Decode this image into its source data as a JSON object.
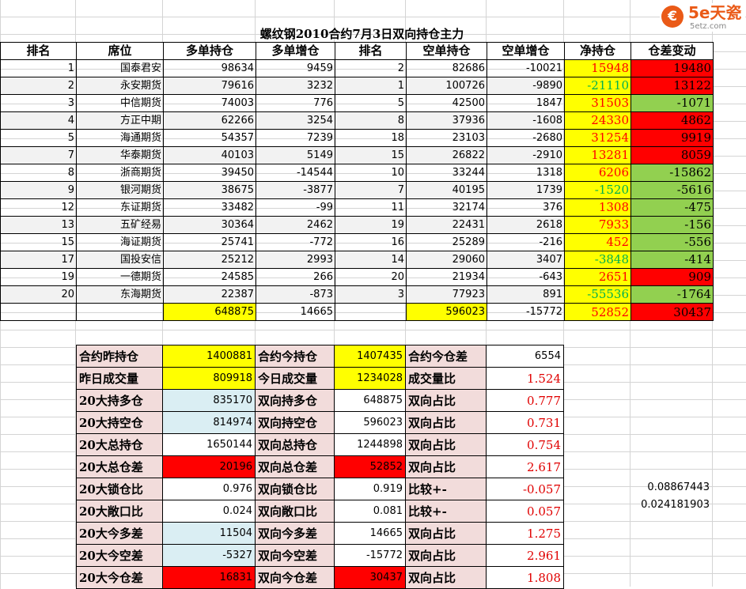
{
  "logo": {
    "icon_text": "€",
    "name": "5e天瓷",
    "url": "5etz.com"
  },
  "title": "螺纹钢2010合约7月3日双向持仓主力",
  "colors": {
    "yellow": "#ffff00",
    "red": "#ff0000",
    "green": "#92d050",
    "light_blue": "#daeef3",
    "pink": "#f2dcdb",
    "net_red_text": "#ff0000",
    "net_green_text": "#00b050"
  },
  "headers": [
    "排名",
    "席位",
    "多单持仓",
    "多单增仓",
    "排名",
    "空单持仓",
    "空单增仓",
    "净持仓",
    "仓差变动"
  ],
  "rows": [
    {
      "rank": "1",
      "broker": "国泰君安",
      "long": "98634",
      "long_chg": "9459",
      "rank2": "2",
      "short": "82686",
      "short_chg": "-10021",
      "net": "15948",
      "diff": "19480"
    },
    {
      "rank": "2",
      "broker": "永安期货",
      "long": "79616",
      "long_chg": "3232",
      "rank2": "1",
      "short": "100726",
      "short_chg": "-9890",
      "net": "-21110",
      "diff": "13122"
    },
    {
      "rank": "3",
      "broker": "中信期货",
      "long": "74003",
      "long_chg": "776",
      "rank2": "5",
      "short": "42500",
      "short_chg": "1847",
      "net": "31503",
      "diff": "-1071"
    },
    {
      "rank": "4",
      "broker": "方正中期",
      "long": "62266",
      "long_chg": "3254",
      "rank2": "8",
      "short": "37936",
      "short_chg": "-1608",
      "net": "24330",
      "diff": "4862"
    },
    {
      "rank": "5",
      "broker": "海通期货",
      "long": "54357",
      "long_chg": "7239",
      "rank2": "18",
      "short": "23103",
      "short_chg": "-2680",
      "net": "31254",
      "diff": "9919"
    },
    {
      "rank": "7",
      "broker": "华泰期货",
      "long": "40103",
      "long_chg": "5149",
      "rank2": "15",
      "short": "26822",
      "short_chg": "-2910",
      "net": "13281",
      "diff": "8059"
    },
    {
      "rank": "8",
      "broker": "浙商期货",
      "long": "39450",
      "long_chg": "-14544",
      "rank2": "10",
      "short": "33244",
      "short_chg": "1318",
      "net": "6206",
      "diff": "-15862"
    },
    {
      "rank": "9",
      "broker": "银河期货",
      "long": "38675",
      "long_chg": "-3877",
      "rank2": "7",
      "short": "40195",
      "short_chg": "1739",
      "net": "-1520",
      "diff": "-5616"
    },
    {
      "rank": "12",
      "broker": "东证期货",
      "long": "33482",
      "long_chg": "-99",
      "rank2": "11",
      "short": "32174",
      "short_chg": "376",
      "net": "1308",
      "diff": "-475"
    },
    {
      "rank": "13",
      "broker": "五矿经易",
      "long": "30364",
      "long_chg": "2462",
      "rank2": "19",
      "short": "22431",
      "short_chg": "2618",
      "net": "7933",
      "diff": "-156"
    },
    {
      "rank": "15",
      "broker": "海证期货",
      "long": "25741",
      "long_chg": "-772",
      "rank2": "16",
      "short": "25289",
      "short_chg": "-216",
      "net": "452",
      "diff": "-556"
    },
    {
      "rank": "17",
      "broker": "国投安信",
      "long": "25212",
      "long_chg": "2993",
      "rank2": "14",
      "short": "29060",
      "short_chg": "3407",
      "net": "-3848",
      "diff": "-414"
    },
    {
      "rank": "19",
      "broker": "一德期货",
      "long": "24585",
      "long_chg": "266",
      "rank2": "20",
      "short": "21934",
      "short_chg": "-643",
      "net": "2651",
      "diff": "909"
    },
    {
      "rank": "20",
      "broker": "东海期货",
      "long": "22387",
      "long_chg": "-873",
      "rank2": "3",
      "short": "77923",
      "short_chg": "891",
      "net": "-55536",
      "diff": "-1764"
    }
  ],
  "totals": {
    "long": "648875",
    "long_chg": "14665",
    "short": "596023",
    "short_chg": "-15772",
    "net": "52852",
    "diff": "30437"
  },
  "summary": [
    {
      "l1": "合约昨持仓",
      "v1": "1400881",
      "l2": "合约今持仓",
      "v2": "1407435",
      "l3": "合约今仓差",
      "v3": "6554"
    },
    {
      "l1": "昨日成交量",
      "v1": "809918",
      "l2": "今日成交量",
      "v2": "1234028",
      "l3": "成交量比",
      "v3": "1.524"
    },
    {
      "l1": "20大持多仓",
      "v1": "835170",
      "l2": "双向持多仓",
      "v2": "648875",
      "l3": "双向占比",
      "v3": "0.777"
    },
    {
      "l1": "20大持空仓",
      "v1": "814974",
      "l2": "双向持空仓",
      "v2": "596023",
      "l3": "双向占比",
      "v3": "0.731"
    },
    {
      "l1": "20大总持仓",
      "v1": "1650144",
      "l2": "双向总持仓",
      "v2": "1244898",
      "l3": "双向占比",
      "v3": "0.754"
    },
    {
      "l1": "20大总仓差",
      "v1": "20196",
      "l2": "双向总仓差",
      "v2": "52852",
      "l3": "双向占比",
      "v3": "2.617"
    },
    {
      "l1": "20大锁仓比",
      "v1": "0.976",
      "l2": "双向锁仓比",
      "v2": "0.919",
      "l3": "比较+-",
      "v3": "-0.057"
    },
    {
      "l1": "20大敞口比",
      "v1": "0.024",
      "l2": "双向敞口比",
      "v2": "0.081",
      "l3": "比较+-",
      "v3": "0.057"
    },
    {
      "l1": "20大今多差",
      "v1": "11504",
      "l2": "双向今多差",
      "v2": "14665",
      "l3": "双向占比",
      "v3": "1.275"
    },
    {
      "l1": "20大今空差",
      "v1": "-5327",
      "l2": "双向今空差",
      "v2": "-15772",
      "l3": "双向占比",
      "v3": "2.961"
    },
    {
      "l1": "20大今仓差",
      "v1": "16831",
      "l2": "双向今仓差",
      "v2": "30437",
      "l3": "双向占比",
      "v3": "1.808"
    }
  ],
  "extra": {
    "v1": "0.08867443",
    "v2": "0.024181903"
  }
}
